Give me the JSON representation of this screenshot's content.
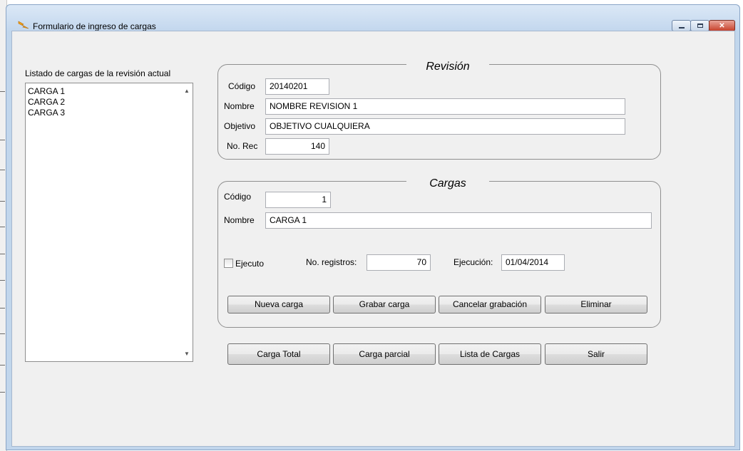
{
  "window": {
    "title": "Formulario de ingreso de cargas"
  },
  "list": {
    "label": "Listado de cargas de la revisión actual",
    "items": [
      "CARGA 1",
      "CARGA 2",
      "CARGA 3"
    ]
  },
  "revision": {
    "legend": "Revisión",
    "codigo_label": "Código",
    "codigo_value": "20140201",
    "nombre_label": "Nombre",
    "nombre_value": "NOMBRE REVISION 1",
    "objetivo_label": "Objetivo",
    "objetivo_value": "OBJETIVO CUALQUIERA",
    "norec_label": "No. Rec",
    "norec_value": "140"
  },
  "cargas": {
    "legend": "Cargas",
    "codigo_label": "Código",
    "codigo_value": "1",
    "nombre_label": "Nombre",
    "nombre_value": "CARGA 1",
    "ejecuto_label": "Ejecuto",
    "ejecuto_checked": false,
    "registros_label": "No. registros:",
    "registros_value": "70",
    "ejecucion_label": "Ejecución:",
    "ejecucion_value": "01/04/2014",
    "buttons": {
      "nueva": "Nueva carga",
      "grabar": "Grabar carga",
      "cancelar": "Cancelar grabación",
      "eliminar": "Eliminar"
    }
  },
  "bottom_buttons": {
    "carga_total": "Carga Total",
    "carga_parcial": "Carga parcial",
    "lista": "Lista de Cargas",
    "salir": "Salir"
  },
  "icons": {
    "app": "lightning-app-icon",
    "minimize": "minimize-icon",
    "maximize": "maximize-icon",
    "close": "close-icon"
  }
}
